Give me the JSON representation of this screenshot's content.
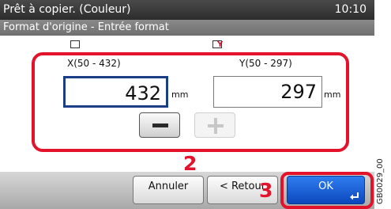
{
  "status_bar": {
    "title": "Prêt à copier. (Couleur)",
    "clock": "10:10"
  },
  "screen": {
    "subtitle": "Format d'origine - Entrée format"
  },
  "inputs": {
    "x": {
      "range_label": "X(50 - 432)",
      "value": "432",
      "unit": "mm",
      "selected": true
    },
    "y": {
      "range_label": "Y(50 - 297)",
      "value": "297",
      "unit": "mm",
      "selected": false
    }
  },
  "stepper": {
    "minus_icon": "minus-icon",
    "plus_icon": "plus-icon",
    "plus_enabled": false
  },
  "callouts": {
    "step_2": "2",
    "step_3": "3"
  },
  "actions": {
    "cancel_label": "Annuler",
    "back_label": "< Retour",
    "ok_label": "OK",
    "ok_icon": "enter-icon"
  },
  "figure_code": "GB0029_00",
  "colors": {
    "highlight_red": "#e2132b",
    "ok_blue": "#1a5fd8",
    "selected_border": "#1b3f86"
  }
}
